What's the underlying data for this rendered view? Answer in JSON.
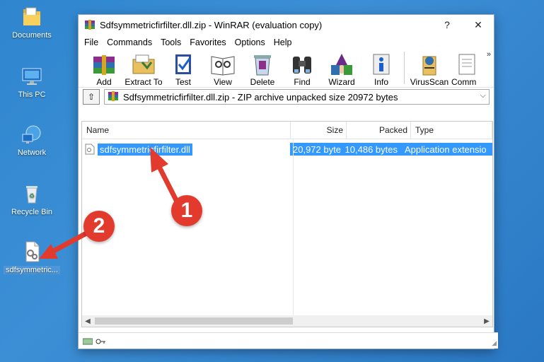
{
  "desktop": {
    "icons": [
      {
        "label": "Documents",
        "icon": "folder-icon"
      },
      {
        "label": "This PC",
        "icon": "monitor-icon"
      },
      {
        "label": "Network",
        "icon": "network-icon"
      },
      {
        "label": "Recycle Bin",
        "icon": "recycle-bin-icon"
      },
      {
        "label": "sdfsymmetric...",
        "icon": "dll-file-icon"
      }
    ]
  },
  "window": {
    "title": "Sdfsymmetricfirfilter.dll.zip - WinRAR (evaluation copy)",
    "help_btn": "?",
    "close_btn": "✕"
  },
  "menu": [
    "File",
    "Commands",
    "Tools",
    "Favorites",
    "Options",
    "Help"
  ],
  "toolbar": [
    "Add",
    "Extract To",
    "Test",
    "View",
    "Delete",
    "Find",
    "Wizard",
    "Info",
    "VirusScan",
    "Comm"
  ],
  "toolbar_more": "»",
  "address": {
    "up_icon": "⇧",
    "text": "Sdfsymmetricfirfilter.dll.zip - ZIP archive unpacked size 20972 bytes",
    "dropdown": "⌵"
  },
  "columns": {
    "name": "Name",
    "size": "Size",
    "packed": "Packed",
    "type": "Type"
  },
  "files": [
    {
      "name": "sdfsymmetricfirfilter.dll",
      "size": "20,972 byte",
      "packed": "10,486 bytes",
      "type": "Application extensio"
    }
  ],
  "annotations": {
    "one": "1",
    "two": "2"
  },
  "colors": {
    "accent": "#3399ff",
    "annotation": "#e23b2e",
    "desktop": "#2f86cf"
  }
}
